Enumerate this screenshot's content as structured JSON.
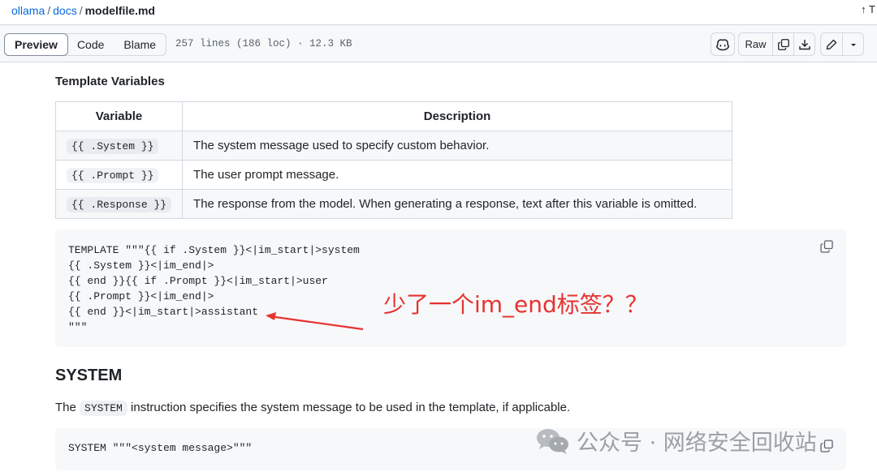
{
  "breadcrumb": {
    "repo": "ollama",
    "folder": "docs",
    "file": "modelfile.md",
    "sep": "/"
  },
  "top_right": "↑ T",
  "toolbar": {
    "tabs": [
      "Preview",
      "Code",
      "Blame"
    ],
    "active_tab": "Preview",
    "file_info": "257 lines (186 loc) · 12.3 KB",
    "raw_label": "Raw"
  },
  "section": {
    "heading": "Template Variables",
    "table": {
      "headers": [
        "Variable",
        "Description"
      ],
      "rows": [
        [
          "{{ .System }}",
          "The system message used to specify custom behavior."
        ],
        [
          "{{ .Prompt }}",
          "The user prompt message."
        ],
        [
          "{{ .Response }}",
          "The response from the model. When generating a response, text after this variable is omitted."
        ]
      ]
    },
    "code_block": "TEMPLATE \"\"\"{{ if .System }}<|im_start|>system\n{{ .System }}<|im_end|>\n{{ end }}{{ if .Prompt }}<|im_start|>user\n{{ .Prompt }}<|im_end|>\n{{ end }}<|im_start|>assistant\n\"\"\""
  },
  "annotation": {
    "text": "少了一个im_end标签？？",
    "color": "#e8322e"
  },
  "system_section": {
    "heading": "SYSTEM",
    "para_before": "The",
    "para_code": "SYSTEM",
    "para_after": "instruction specifies the system message to be used in the template, if applicable.",
    "code_block": "SYSTEM \"\"\"<system message>\"\"\""
  },
  "watermark": {
    "text": "公众号 · 网络安全回收站",
    "icon": "wechat-icon"
  },
  "colors": {
    "link": "#0969da",
    "border": "#d1d9e0",
    "code_bg": "#f6f8fa"
  }
}
